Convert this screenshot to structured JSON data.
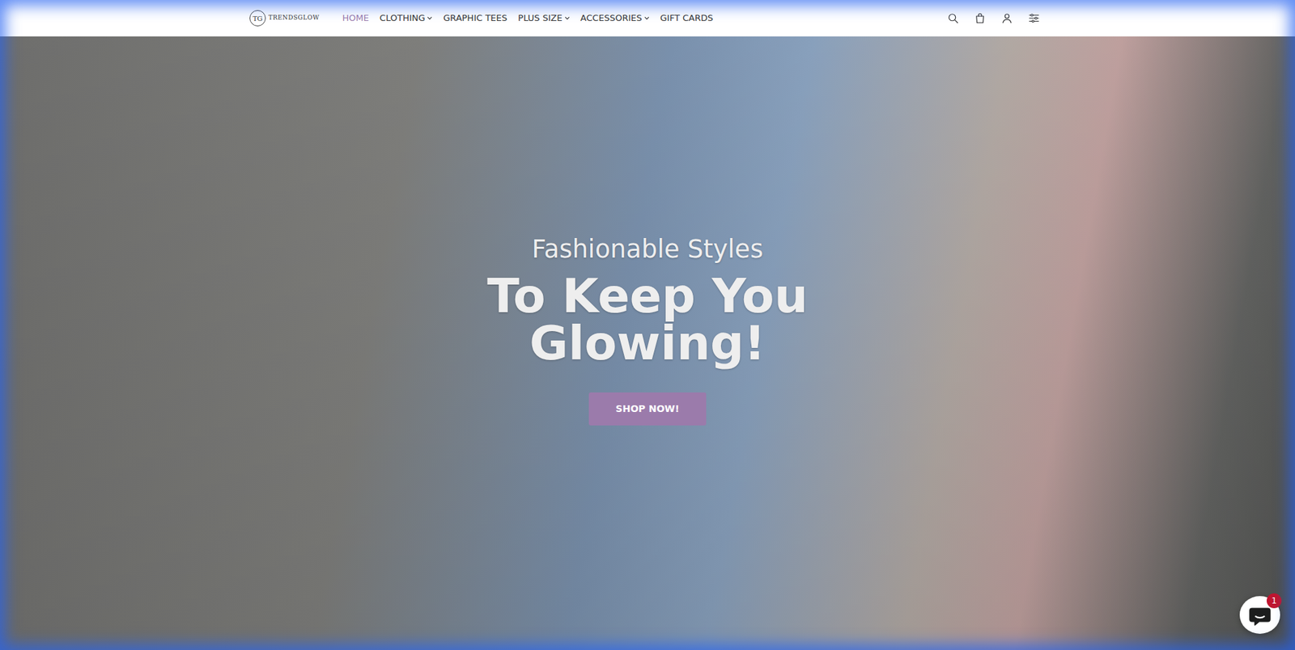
{
  "logo": {
    "mark": "TG",
    "name": "TRENDSGLOW"
  },
  "nav": {
    "items": [
      {
        "label": "HOME",
        "selected": true,
        "dropdown": false
      },
      {
        "label": "CLOTHING",
        "selected": false,
        "dropdown": true
      },
      {
        "label": "GRAPHIC TEES",
        "selected": false,
        "dropdown": false
      },
      {
        "label": "PLUS SIZE",
        "selected": false,
        "dropdown": true
      },
      {
        "label": "ACCESSORIES",
        "selected": false,
        "dropdown": true
      },
      {
        "label": "GIFT CARDS",
        "selected": false,
        "dropdown": false
      }
    ]
  },
  "hero": {
    "subtitle": "Fashionable Styles",
    "title": "To Keep You Glowing!",
    "button": "SHOP NOW!"
  },
  "chat": {
    "badge": "1"
  }
}
